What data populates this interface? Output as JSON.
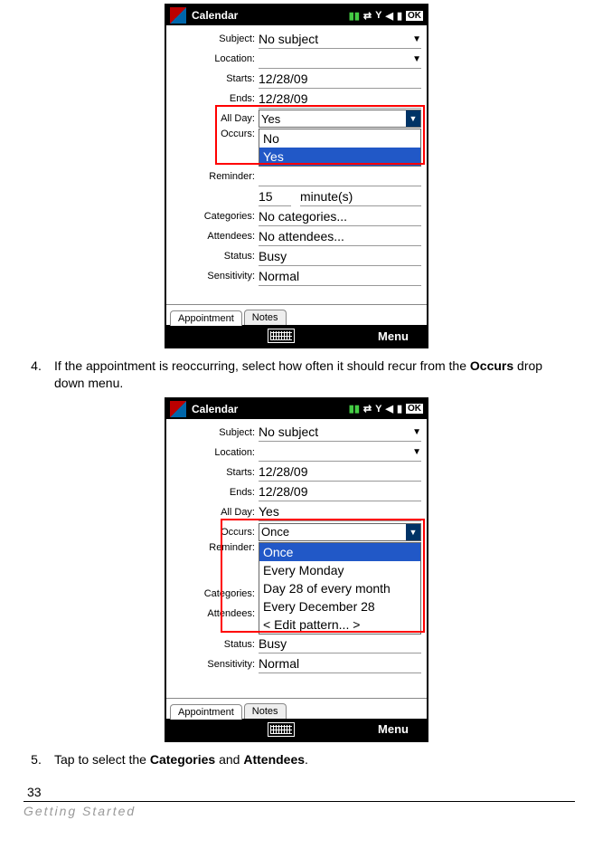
{
  "statusbar": {
    "title": "Calendar",
    "ok": "OK"
  },
  "labels": {
    "subject": "Subject:",
    "location": "Location:",
    "starts": "Starts:",
    "ends": "Ends:",
    "allday": "All Day:",
    "occurs": "Occurs:",
    "reminder": "Reminder:",
    "categories": "Categories:",
    "attendees": "Attendees:",
    "status": "Status:",
    "sensitivity": "Sensitivity:"
  },
  "s1": {
    "subject": "No subject",
    "location": "",
    "starts": "12/28/09",
    "ends": "12/28/09",
    "allday_box": "Yes",
    "opt_no": "No",
    "opt_yes": "Yes",
    "reminder_val": "",
    "mins": "15",
    "mins_unit": "minute(s)",
    "categories": "No categories...",
    "attendees": "No attendees...",
    "status": "Busy",
    "sensitivity": "Normal"
  },
  "s2": {
    "subject": "No subject",
    "location": "",
    "starts": "12/28/09",
    "ends": "12/28/09",
    "allday": "Yes",
    "occurs_box": "Once",
    "opt_once": "Once",
    "opt_mon": "Every Monday",
    "opt_d28": "Day 28 of every month",
    "opt_dec": "Every December 28",
    "opt_edit": "< Edit pattern... >",
    "status": "Busy",
    "sensitivity": "Normal"
  },
  "tabs": {
    "a": "Appointment",
    "b": "Notes"
  },
  "softbar": {
    "menu": "Menu"
  },
  "instr": {
    "n4": "4.",
    "t4a": "If the appointment is reoccurring, select how often it should recur from the ",
    "t4b": "Occurs",
    "t4c": " drop down menu.",
    "n5": "5.",
    "t5a": "Tap to select the ",
    "t5b": "Categories",
    "t5c": " and ",
    "t5d": "Attendees",
    "t5e": "."
  },
  "page": {
    "num": "33",
    "footer": "Getting Started"
  },
  "blank": " "
}
